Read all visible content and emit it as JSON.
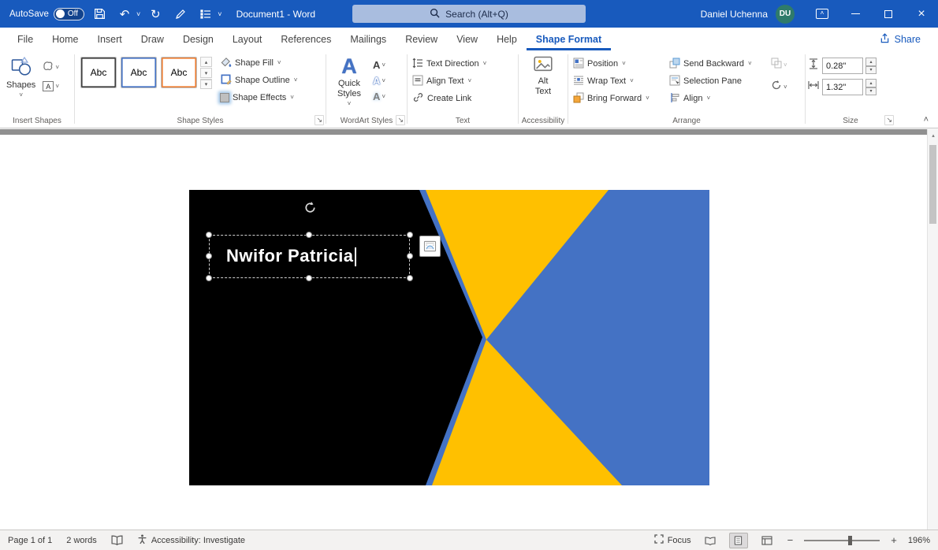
{
  "glyphs": {
    "chevron": "˅",
    "collapse": "˄",
    "up": "▴",
    "down": "▾",
    "close": "×",
    "launcher": "↘",
    "minus": "−",
    "plus": "+",
    "undo": "↶",
    "redo": "↻",
    "letter_a": "A",
    "abc": "Abc"
  },
  "colors": {
    "titlebar": "#185abd",
    "card_blue": "#4472c4",
    "card_yellow": "#ffc000",
    "card_black": "#000000"
  },
  "titlebar": {
    "autosave_label": "AutoSave",
    "autosave_state": "Off",
    "doc_title": "Document1 - Word",
    "search_placeholder": "Search (Alt+Q)",
    "user_name": "Daniel Uchenna",
    "user_initials": "DU"
  },
  "tabs": {
    "items": [
      "File",
      "Home",
      "Insert",
      "Draw",
      "Design",
      "Layout",
      "References",
      "Mailings",
      "Review",
      "View",
      "Help",
      "Shape Format"
    ],
    "share": "Share"
  },
  "ribbon": {
    "insert_shapes": {
      "label": "Insert Shapes",
      "shapes": "Shapes"
    },
    "shape_styles": {
      "label": "Shape Styles",
      "fill": "Shape Fill",
      "outline": "Shape Outline",
      "effects": "Shape Effects"
    },
    "wordart": {
      "label": "WordArt Styles",
      "quick_styles": "Quick Styles"
    },
    "text_group": {
      "label": "Text",
      "direction": "Text Direction",
      "align": "Align Text",
      "link": "Create Link"
    },
    "accessibility_group": {
      "label": "Accessibility",
      "alt_text": "Alt Text"
    },
    "arrange": {
      "label": "Arrange",
      "position": "Position",
      "wrap": "Wrap Text",
      "bring_forward": "Bring Forward",
      "send_backward": "Send Backward",
      "selection_pane": "Selection Pane",
      "align": "Align"
    },
    "size": {
      "label": "Size",
      "height": "0.28\"",
      "width": "1.32\""
    }
  },
  "document": {
    "shape_text": "Nwifor Patricia"
  },
  "statusbar": {
    "page": "Page 1 of 1",
    "words": "2 words",
    "accessibility": "Accessibility: Investigate",
    "focus": "Focus",
    "zoom": "196%"
  }
}
